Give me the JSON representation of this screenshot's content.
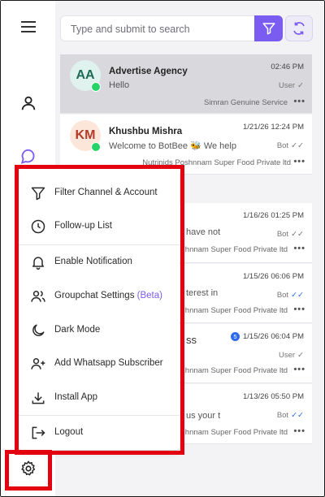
{
  "search": {
    "placeholder": "Type and submit to search"
  },
  "chats": [
    {
      "initials": "AA",
      "name": "Advertise Agency",
      "message": "Hello",
      "time": "02:46 PM",
      "sender": "User",
      "footer": "Simran Genuine Service",
      "avatar_bg": "#dff2ee",
      "avatar_fg": "#1d6a57",
      "selected": true
    },
    {
      "initials": "KM",
      "name": "Khushbu Mishra",
      "message": "Welcome to BotBee 🐝 We help",
      "time": "1/21/26 12:24 PM",
      "sender": "Bot",
      "footer": "Nutrinids Poshnnam Super Food Private ltd",
      "avatar_bg": "#fbe6d9",
      "avatar_fg": "#b43a2a",
      "selected": false
    },
    {
      "message_fragment": "have not",
      "time": "1/16/26 01:25 PM",
      "sender": "Bot",
      "footer": "hnnam Super Food Private ltd"
    },
    {
      "message_fragment": "terest in",
      "time": "1/15/26 06:06 PM",
      "sender": "Bot",
      "footer": "hnnam Super Food Private ltd"
    },
    {
      "name_fragment": "ss",
      "badge": "5",
      "time": "1/15/26 06:04 PM",
      "sender": "User",
      "footer": "hnnam Super Food Private ltd"
    },
    {
      "message_fragment": "us your t",
      "time": "1/13/26 05:50 PM",
      "sender": "Bot",
      "footer": "hnnam Super Food Private ltd"
    }
  ],
  "menu": {
    "items": [
      {
        "label": "Filter Channel & Account",
        "icon": "filter-icon"
      },
      {
        "label": "Follow-up List",
        "icon": "clock-icon"
      },
      {
        "label": "Enable Notification",
        "icon": "bell-icon"
      },
      {
        "label": "Groupchat Settings",
        "beta": "(Beta)",
        "icon": "users-icon"
      },
      {
        "label": "Dark Mode",
        "icon": "moon-icon"
      },
      {
        "label": "Add Whatsapp Subscriber",
        "icon": "user-plus-icon"
      },
      {
        "label": "Install App",
        "icon": "download-icon"
      },
      {
        "label": "Logout",
        "icon": "logout-icon"
      }
    ]
  },
  "colors": {
    "accent": "#7b5cf0",
    "highlight": "#e3000f",
    "whatsapp": "#25d366",
    "read_tick": "#2d6bea"
  }
}
